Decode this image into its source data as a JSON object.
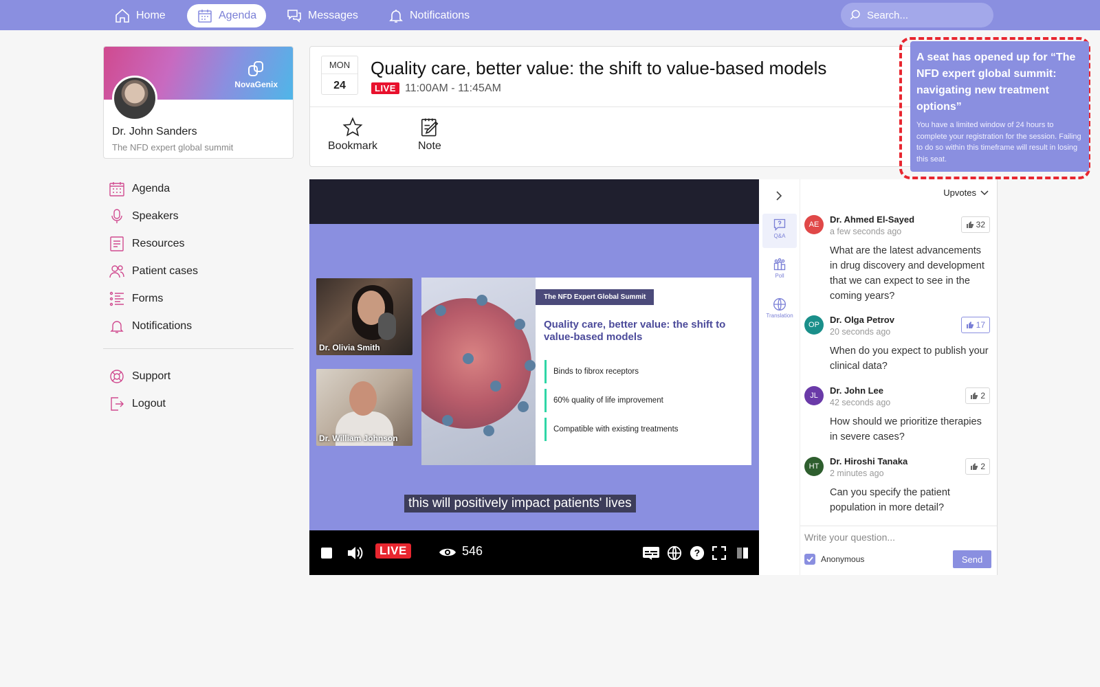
{
  "nav": {
    "home": "Home",
    "agenda": "Agenda",
    "messages": "Messages",
    "notifications": "Notifications",
    "search_placeholder": "Search..."
  },
  "profile": {
    "brand": "NovaGenix",
    "name": "Dr. John Sanders",
    "event": "The NFD expert global summit"
  },
  "sidebar": {
    "items": [
      {
        "label": "Agenda",
        "icon": "calendar-icon"
      },
      {
        "label": "Speakers",
        "icon": "microphone-icon"
      },
      {
        "label": "Resources",
        "icon": "document-icon"
      },
      {
        "label": "Patient cases",
        "icon": "users-icon"
      },
      {
        "label": "Forms",
        "icon": "list-icon"
      },
      {
        "label": "Notifications",
        "icon": "bell-icon"
      }
    ],
    "footer": [
      {
        "label": "Support",
        "icon": "support-icon"
      },
      {
        "label": "Logout",
        "icon": "logout-icon"
      }
    ],
    "icon_color": "#d04a8f"
  },
  "session": {
    "day": "MON",
    "date": "24",
    "title": "Quality care, better value: the shift to value-based models",
    "live": "LIVE",
    "time": "11:00AM - 11:45AM",
    "bookmark": "Bookmark",
    "note": "Note"
  },
  "toast": {
    "title": "A seat has opened up for “The NFD expert global summit: navigating new treatment options”",
    "body": "You have a limited window of 24 hours to complete your registration for the session. Failing to do so within this timeframe will result in losing this seat."
  },
  "video": {
    "speakers": [
      "Dr. Olivia Smith",
      "Dr. William Johnson"
    ],
    "slide_tag": "The NFD Expert Global Summit",
    "slide_title": "Quality care, better value: the shift to value-based models",
    "bullets": [
      "Binds to fibrox receptors",
      "60% quality of life improvement",
      "Compatible with existing treatments"
    ],
    "caption": "this will positively impact patients' lives",
    "live": "LIVE",
    "viewers": "546"
  },
  "rail": {
    "qa": "Q&A",
    "poll": "Poll",
    "translation": "Translation"
  },
  "qa": {
    "sort": "Upvotes",
    "questions": [
      {
        "initials": "AE",
        "color": "#e04848",
        "name": "Dr. Ahmed El-Sayed",
        "time": "a few seconds ago",
        "text": "What are the latest advancements in drug discovery and development that we can expect to see in the coming years?",
        "votes": "32"
      },
      {
        "initials": "OP",
        "color": "#1a8f8a",
        "name": "Dr. Olga Petrov",
        "time": "20 seconds ago",
        "text": "When do you expect to publish your clinical data?",
        "votes": "17"
      },
      {
        "initials": "JL",
        "color": "#6a3aa8",
        "name": "Dr. John Lee",
        "time": "42 seconds ago",
        "text": "How should we prioritize therapies in severe cases?",
        "votes": "2"
      },
      {
        "initials": "HT",
        "color": "#2e5e2e",
        "name": "Dr. Hiroshi Tanaka",
        "time": "2 minutes ago",
        "text": "Can you specify the patient population in more detail?",
        "votes": "2"
      }
    ],
    "input_placeholder": "Write your question...",
    "anonymous": "Anonymous",
    "send": "Send"
  },
  "colors": {
    "accent": "#8a8fe0",
    "live": "#e8112d",
    "toast_border": "#e8262f",
    "bullet": "#2fd6a6"
  }
}
